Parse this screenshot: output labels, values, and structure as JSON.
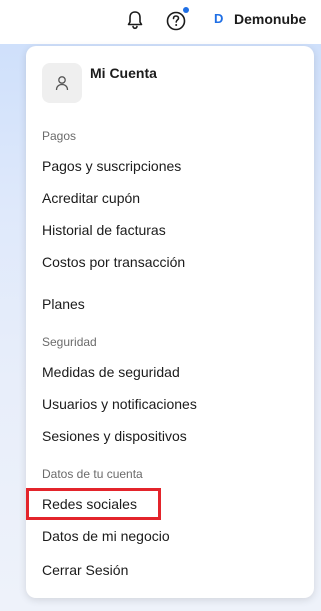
{
  "header": {
    "notifications_icon": "bell-icon",
    "help_icon": "question-circle-icon",
    "help_badge_color": "#1f6fe5",
    "avatar_initial": "D",
    "username": "Demonube"
  },
  "menu": {
    "account_icon": "user-icon",
    "account_title": "Mi Cuenta",
    "sections": [
      {
        "label": "Pagos",
        "items": [
          "Pagos y suscripciones",
          "Acreditar cupón",
          "Historial de facturas",
          "Costos por transacción"
        ]
      },
      {
        "label": "",
        "items": [
          "Planes"
        ]
      },
      {
        "label": "Seguridad",
        "items": [
          "Medidas de seguridad",
          "Usuarios y notificaciones",
          "Sesiones y dispositivos"
        ]
      },
      {
        "label": "Datos de tu cuenta",
        "items": [
          "Redes sociales",
          "Datos de mi negocio",
          "Cerrar Sesión"
        ]
      }
    ],
    "highlighted_item": "Redes sociales",
    "highlight_color": "#e3242b"
  }
}
